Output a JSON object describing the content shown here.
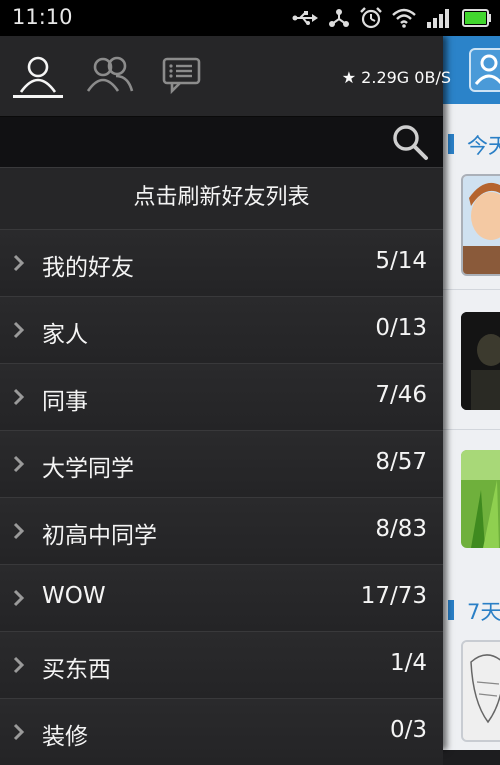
{
  "status_bar": {
    "time": "11:10",
    "icons": [
      "usb-icon",
      "share-icon",
      "alarm-icon",
      "wifi-icon",
      "signal-icon",
      "battery-icon"
    ]
  },
  "drawer": {
    "tabs": [
      {
        "id": "contacts",
        "icon": "person-icon",
        "active": true
      },
      {
        "id": "groups",
        "icon": "people-icon",
        "active": false
      },
      {
        "id": "messages",
        "icon": "message-icon",
        "active": false
      }
    ],
    "storage_info": "★ 2.29G  0B/S",
    "search": {
      "value": "",
      "placeholder": ""
    },
    "refresh_label": "点击刷新好友列表",
    "groups": [
      {
        "name": "我的好友",
        "count": "5/14"
      },
      {
        "name": "家人",
        "count": "0/13"
      },
      {
        "name": "同事",
        "count": "7/46"
      },
      {
        "name": "大学同学",
        "count": "8/57"
      },
      {
        "name": "初高中同学",
        "count": "8/83"
      },
      {
        "name": "WOW",
        "count": "17/73"
      },
      {
        "name": "买东西",
        "count": "1/4"
      },
      {
        "name": "装修",
        "count": "0/3"
      }
    ]
  },
  "right_panel": {
    "section_today": "今天",
    "section_week": "7天"
  },
  "colors": {
    "accent": "#2b83c9",
    "drawer_bg": "#262628",
    "status_bar_bg": "#000000",
    "battery": "#41d62e"
  }
}
